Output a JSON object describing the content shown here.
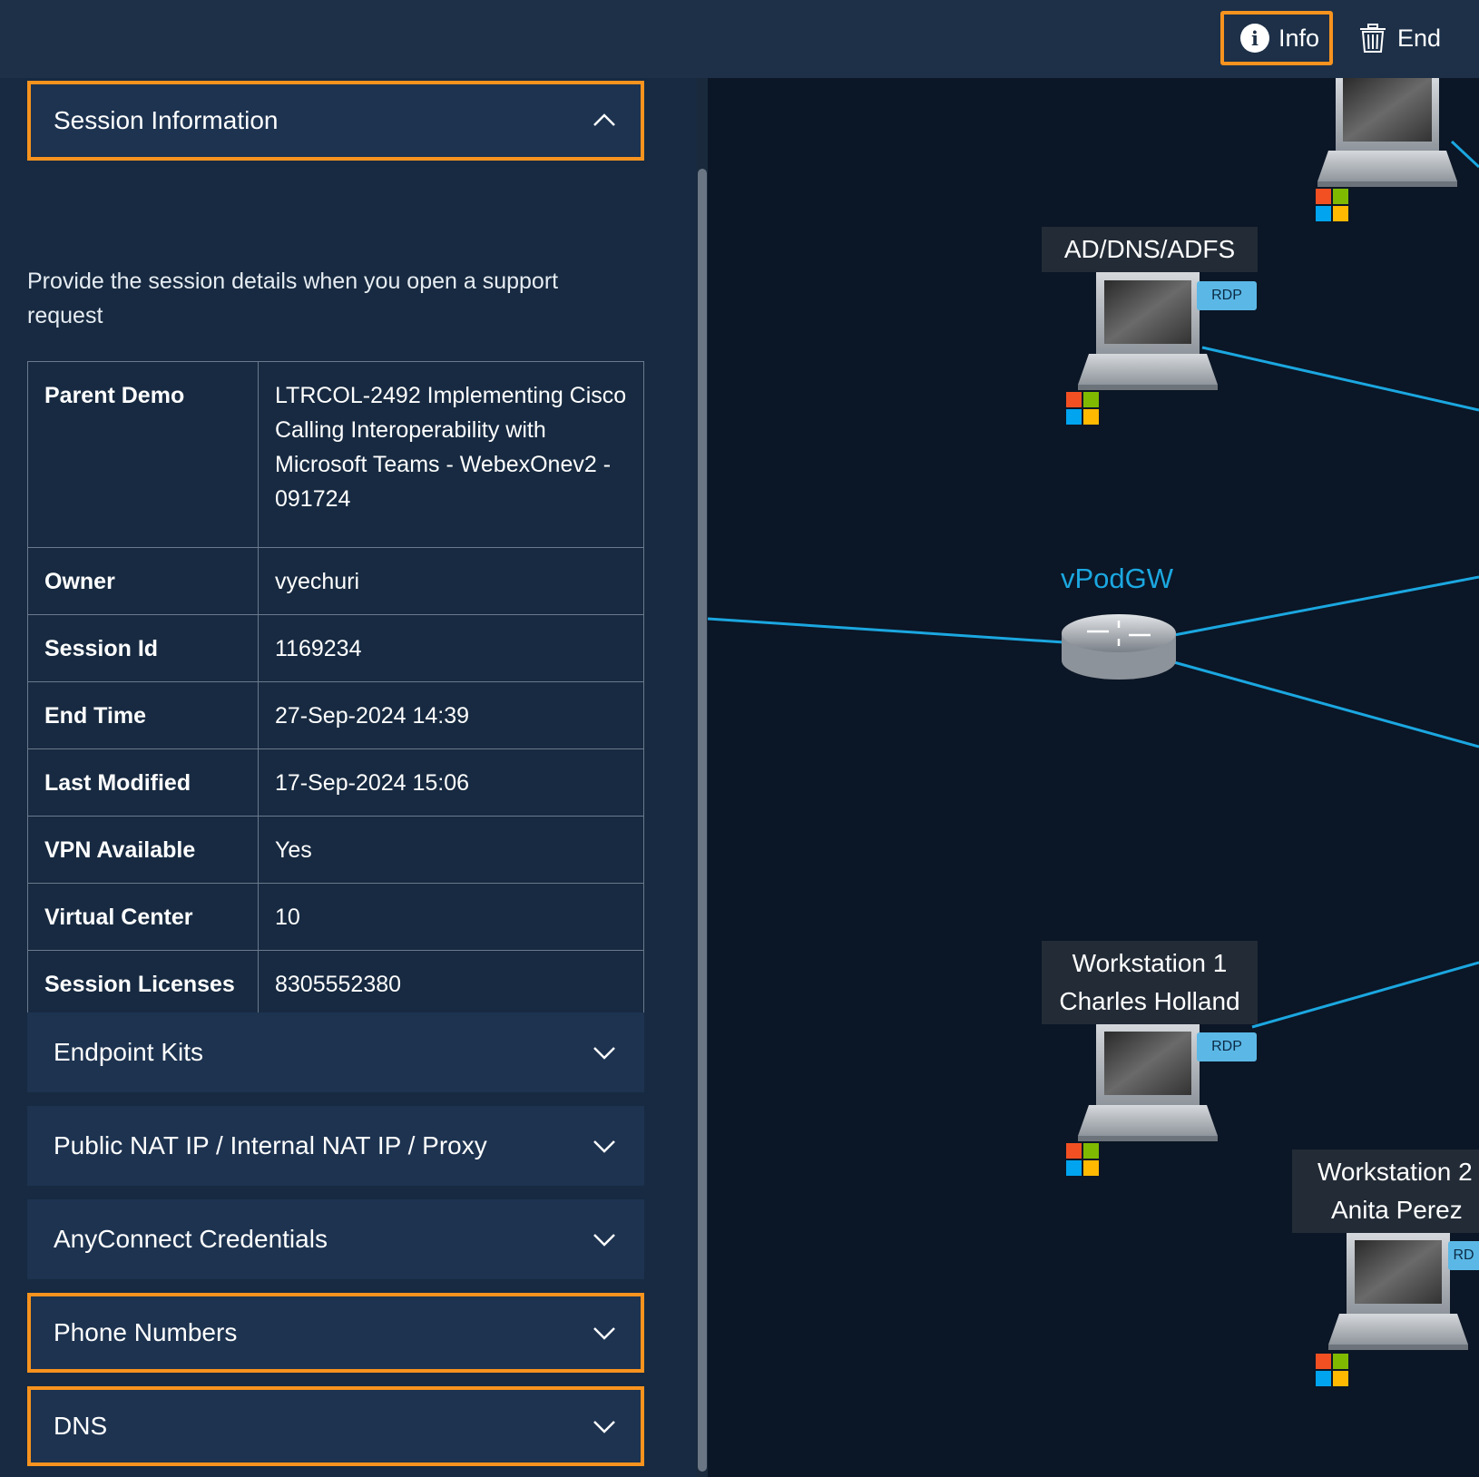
{
  "header": {
    "info_label": "Info",
    "end_label": "End"
  },
  "panel": {
    "session": {
      "title": "Session Information",
      "description": "Provide the session details when you open a support request",
      "rows": [
        {
          "key": "Parent Demo",
          "value": "LTRCOL-2492 Implementing Cisco Calling Interoperability with Microsoft Teams - WebexOnev2 - 091724"
        },
        {
          "key": "Owner",
          "value": "vyechuri"
        },
        {
          "key": "Session Id",
          "value": "1169234"
        },
        {
          "key": "End Time",
          "value": "27-Sep-2024 14:39"
        },
        {
          "key": "Last Modified",
          "value": "17-Sep-2024 15:06"
        },
        {
          "key": "VPN Available",
          "value": "Yes"
        },
        {
          "key": "Virtual Center",
          "value": "10"
        },
        {
          "key": "Session Licenses",
          "value": "8305552380"
        }
      ]
    },
    "sections": [
      {
        "title": "Endpoint Kits"
      },
      {
        "title": "Public NAT IP / Internal NAT IP / Proxy"
      },
      {
        "title": "AnyConnect Credentials"
      },
      {
        "title": "Phone Numbers"
      },
      {
        "title": "DNS"
      }
    ]
  },
  "topology": {
    "ad_label": "AD/DNS/ADFS",
    "router_label": "vPodGW",
    "ws1_line1": "Workstation 1",
    "ws1_line2": "Charles Holland",
    "ws2_line1": "Workstation 2",
    "ws2_line2": "Anita Perez",
    "rdp_label": "RDP",
    "rdp_partial": "RD",
    "link_color": "#1ba7e0",
    "highlight_color": "#f7931e"
  }
}
